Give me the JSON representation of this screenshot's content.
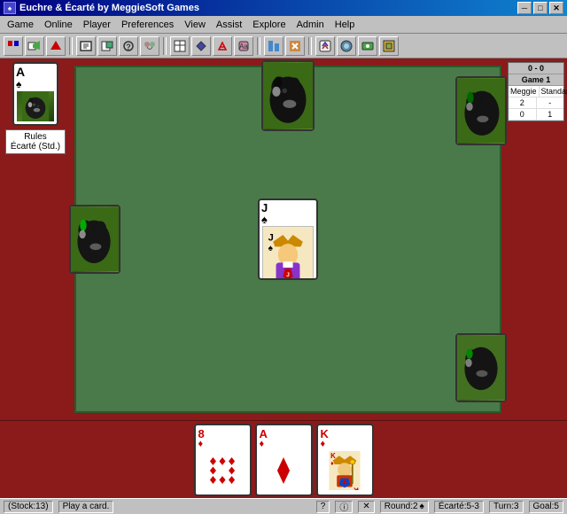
{
  "window": {
    "title": "Euchre & Écarté by MeggieSoft Games",
    "icon": "♠"
  },
  "titlebar_buttons": {
    "minimize": "─",
    "maximize": "□",
    "close": "✕"
  },
  "menubar": {
    "items": [
      "Game",
      "Online",
      "Player",
      "Preferences",
      "View",
      "Assist",
      "Explore",
      "Admin",
      "Help"
    ]
  },
  "left_card": {
    "rank": "A",
    "suit": "♠",
    "suit_symbol": "♠"
  },
  "rules_label": "Rules",
  "game_type": "Écarté (Std.)",
  "score": {
    "header": "0 - 0",
    "game_label": "Game 1",
    "col1": "Meggie",
    "col2": "Standard",
    "row1_c1": "2",
    "row1_c2": "-",
    "row2_c1": "0",
    "row2_c2": "1"
  },
  "center_card": {
    "rank": "J",
    "suit": "♠",
    "label": "Jack of Spades"
  },
  "player_cards": [
    {
      "rank": "8",
      "suit": "♦",
      "color": "red",
      "label": "8 of Diamonds"
    },
    {
      "rank": "A",
      "suit": "♦",
      "color": "red",
      "label": "Ace of Diamonds"
    },
    {
      "rank": "K",
      "suit": "♦",
      "color": "red",
      "label": "King of Diamonds"
    }
  ],
  "statusbar": {
    "stock": "(Stock:13)",
    "play_hint": "Play a card.",
    "question": "?",
    "info": "ⓘ",
    "round": "Round:2",
    "round_suit": "♠",
    "ecarte": "Écarté:5-3",
    "turn": "Turn:3",
    "goal": "Goal:5"
  }
}
